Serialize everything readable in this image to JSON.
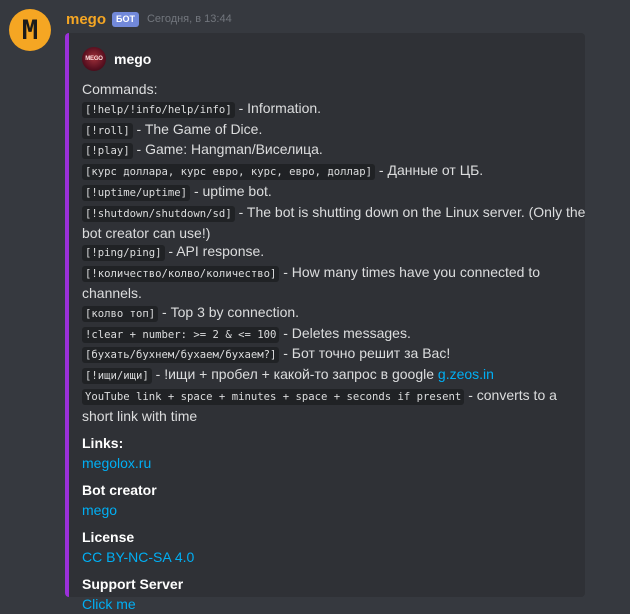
{
  "message": {
    "avatar_letter": "M",
    "username": "mego",
    "bot_tag": "БОТ",
    "timestamp": "Сегодня, в 13:44"
  },
  "embed": {
    "accent_color": "#9b30d9",
    "author": {
      "icon_text": "MEGO",
      "name": "mego"
    },
    "commands_title": "Commands:",
    "commands": [
      {
        "code": "[!help/!info/help/info]",
        "desc": " - Information."
      },
      {
        "code": "[!roll]",
        "desc": " - The Game of Dice."
      },
      {
        "code": "[!play]",
        "desc": " - Game: Hangman/Виселица."
      },
      {
        "code": "[курс доллара, курс евро, курс, евро, доллар]",
        "desc": " - Данные от ЦБ."
      },
      {
        "code": "[!uptime/uptime]",
        "desc": " - uptime bot."
      },
      {
        "code": "[!shutdown/shutdown/sd]",
        "desc_1": " - The bot is shutting down on the Linux server. (Only the",
        "desc_2": "bot creator can use!)"
      },
      {
        "code": "[!ping/ping]",
        "desc": " - API response."
      },
      {
        "code": "[!количество/колво/количество]",
        "desc_1": " - How many times have you connected to",
        "desc_2": "channels."
      },
      {
        "code": "[колво топ]",
        "desc": " - Top 3 by connection."
      },
      {
        "code": "!clear + number: >= 2 & <= 100",
        "desc": " - Deletes messages."
      },
      {
        "code": "[бухать/бухнем/бухаем/бухаем?]",
        "desc": " - Бот точно решит за Вас!"
      },
      {
        "code": "[!ищи/ищи]",
        "desc": " - !ищи + пробел + какой-то запрос в google ",
        "link": "g.zeos.in"
      },
      {
        "code": "YouTube link + space + minutes + space + seconds if present",
        "desc_1": " - converts to a",
        "desc_2": "short link with time"
      }
    ],
    "fields": [
      {
        "name": "Links:",
        "value": "megolox.ru"
      },
      {
        "name": "Bot creator",
        "value": "mego"
      },
      {
        "name": "License",
        "value": "CC BY-NC-SA 4.0"
      },
      {
        "name": "Support Server",
        "value": "Click me"
      }
    ]
  }
}
